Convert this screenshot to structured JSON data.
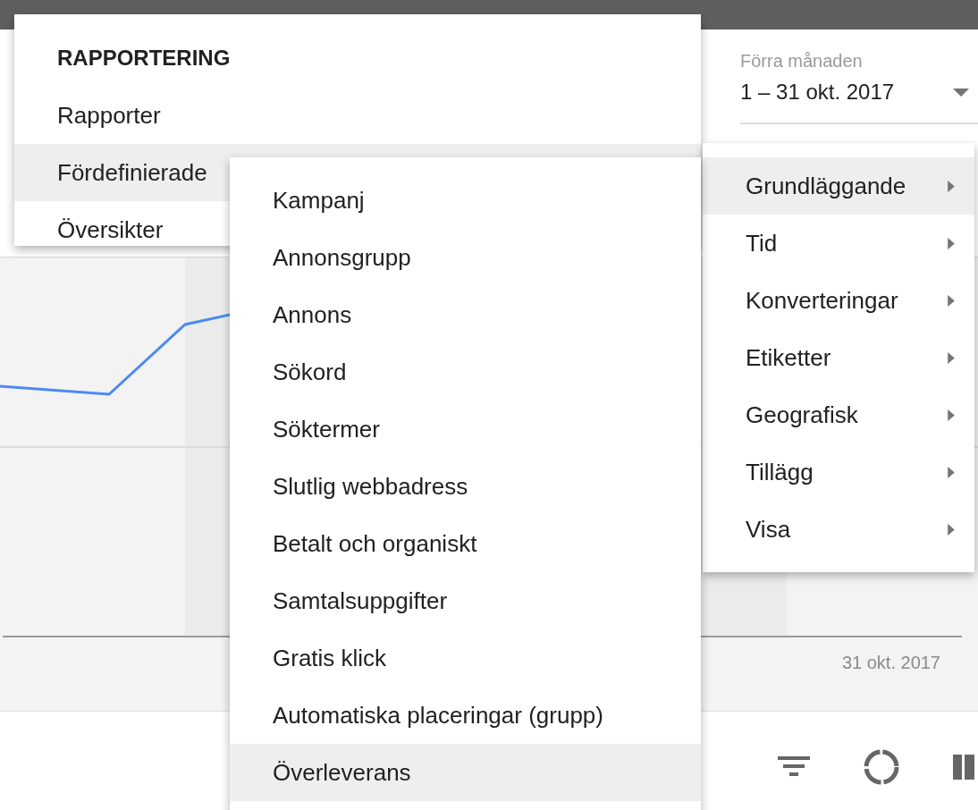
{
  "date_range": {
    "label": "Förra månaden",
    "value": "1 – 31 okt. 2017"
  },
  "chart": {
    "x_label": "31 okt. 2017"
  },
  "reporting_menu": {
    "header": "RAPPORTERING",
    "items": [
      {
        "label": "Rapporter",
        "selected": false
      },
      {
        "label": "Fördefinierade",
        "selected": true
      },
      {
        "label": "Översikter",
        "selected": false
      }
    ]
  },
  "predefined_submenu": {
    "items": [
      {
        "label": "Kampanj",
        "selected": false
      },
      {
        "label": "Annonsgrupp",
        "selected": false
      },
      {
        "label": "Annons",
        "selected": false
      },
      {
        "label": "Sökord",
        "selected": false
      },
      {
        "label": "Söktermer",
        "selected": false
      },
      {
        "label": "Slutlig webbadress",
        "selected": false
      },
      {
        "label": "Betalt och organiskt",
        "selected": false
      },
      {
        "label": "Samtalsuppgifter",
        "selected": false
      },
      {
        "label": "Gratis klick",
        "selected": false
      },
      {
        "label": "Automatiska placeringar (grupp)",
        "selected": false
      },
      {
        "label": "Överleverans",
        "selected": true
      }
    ]
  },
  "category_submenu": {
    "items": [
      {
        "label": "Grundläggande",
        "selected": true
      },
      {
        "label": "Tid",
        "selected": false
      },
      {
        "label": "Konverteringar",
        "selected": false
      },
      {
        "label": "Etiketter",
        "selected": false
      },
      {
        "label": "Geografisk",
        "selected": false
      },
      {
        "label": "Tillägg",
        "selected": false
      },
      {
        "label": "Visa",
        "selected": false
      }
    ]
  }
}
